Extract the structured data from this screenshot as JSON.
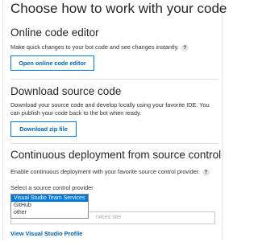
{
  "page": {
    "title": "Choose how to work with your code"
  },
  "online_editor": {
    "title": "Online code editor",
    "description": "Make quick changes to your bot code and see changes instantly.",
    "button": "Open online code editor"
  },
  "download": {
    "title": "Download source code",
    "description": "Download your source code and develop locally using your favorite IDE. You can publish your code back to the bot when ready.",
    "button": "Download zip file"
  },
  "deployment": {
    "title": "Continuous deployment from source control",
    "description": "Enable continuous deployment with your favorite source control provider.",
    "select_label": "Select a source control provider",
    "input_placeholder_visible": "rvices site",
    "options": [
      "Visual Studio Team Services",
      "GitHub",
      "other"
    ],
    "selected_index": 0,
    "link": "View Visual Studio Profile"
  },
  "icons": {
    "help": "?"
  },
  "colors": {
    "accent": "#0078d4",
    "link": "#0063b1",
    "selected_option": "#0078d7"
  }
}
